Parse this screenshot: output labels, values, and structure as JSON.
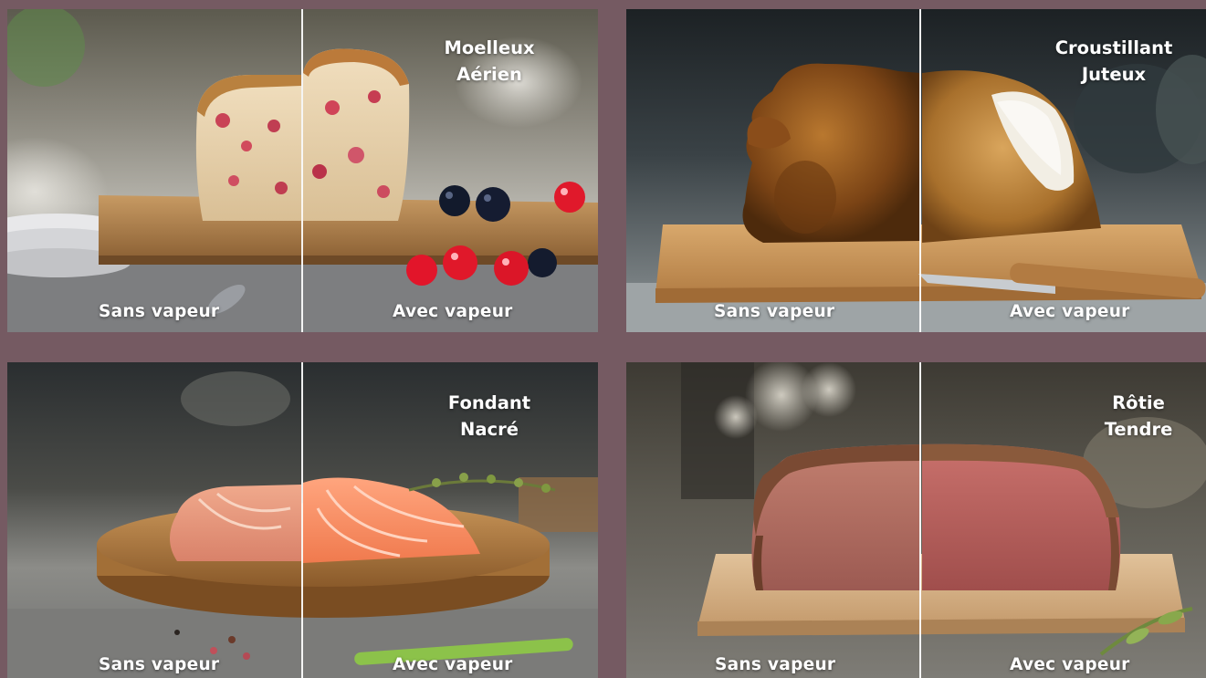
{
  "background_color": "#755a62",
  "tiles": [
    {
      "dish": "cake",
      "left_label": "Sans vapeur",
      "right_label": "Avec vapeur",
      "qualities": [
        "Moelleux",
        "Aérien"
      ]
    },
    {
      "dish": "roast-chicken",
      "left_label": "Sans vapeur",
      "right_label": "Avec vapeur",
      "qualities": [
        "Croustillant",
        "Juteux"
      ]
    },
    {
      "dish": "salmon",
      "left_label": "Sans vapeur",
      "right_label": "Avec vapeur",
      "qualities": [
        "Fondant",
        "Nacré"
      ]
    },
    {
      "dish": "roast-beef",
      "left_label": "Sans vapeur",
      "right_label": "Avec vapeur",
      "qualities": [
        "Rôtie",
        "Tendre"
      ]
    }
  ]
}
